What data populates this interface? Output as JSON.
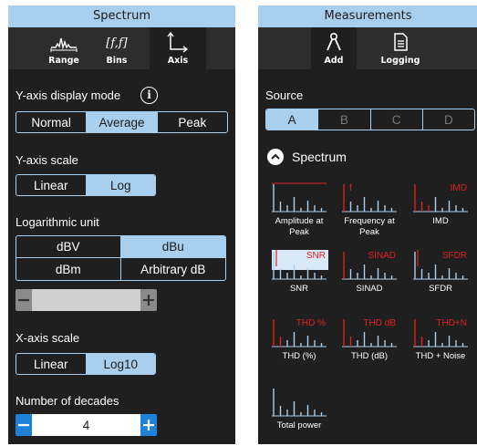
{
  "left_panel": {
    "title": "Spectrum",
    "tabs": [
      {
        "label": "Range",
        "icon": "range-icon"
      },
      {
        "label": "Bins",
        "icon": "bins-icon"
      },
      {
        "label": "Axis",
        "icon": "axis-icon"
      }
    ],
    "selected_tab": "Axis",
    "y_display_mode": {
      "label": "Y-axis display mode",
      "options": [
        "Normal",
        "Average",
        "Peak"
      ],
      "selected": "Average"
    },
    "y_scale": {
      "label": "Y-axis scale",
      "options": [
        "Linear",
        "Log"
      ],
      "selected": "Log"
    },
    "log_unit": {
      "label": "Logarithmic unit",
      "options": [
        "dBV",
        "dBu",
        "dBm",
        "Arbitrary dB"
      ],
      "selected": "dBu",
      "stepper_value": "",
      "stepper_minus": "−",
      "stepper_plus": "+"
    },
    "x_scale": {
      "label": "X-axis scale",
      "options": [
        "Linear",
        "Log10"
      ],
      "selected": "Log10"
    },
    "decades": {
      "label": "Number of decades",
      "value": "4",
      "minus": "−",
      "plus": "+"
    }
  },
  "right_panel": {
    "title": "Measurements",
    "tabs": [
      {
        "label": "Add",
        "icon": "add-probe-icon"
      },
      {
        "label": "Logging",
        "icon": "logging-document-icon"
      }
    ],
    "selected_tab": "Add",
    "source": {
      "label": "Source",
      "options": [
        "A",
        "B",
        "C",
        "D"
      ],
      "selected": "A"
    },
    "section": {
      "title": "Spectrum",
      "icon": "collapse-chevron-icon"
    },
    "tiles": [
      {
        "name": "Amplitude at Peak",
        "overlay": ""
      },
      {
        "name": "Frequency at Peak",
        "overlay": "f"
      },
      {
        "name": "IMD",
        "overlay": "IMD"
      },
      {
        "name": "SNR",
        "overlay": "SNR"
      },
      {
        "name": "SINAD",
        "overlay": "SINAD"
      },
      {
        "name": "SFDR",
        "overlay": "SFDR"
      },
      {
        "name": "THD (%)",
        "overlay": "THD %"
      },
      {
        "name": "THD (dB)",
        "overlay": "THD dB"
      },
      {
        "name": "THD + Noise",
        "overlay": "THD+N"
      },
      {
        "name": "Total power",
        "overlay": ""
      }
    ],
    "colors": {
      "overlay_red": "#e02020",
      "bars": "#a9cfee",
      "highlight": "#a9cfee"
    }
  },
  "colors": {
    "accent": "#a9cfee",
    "panel_bg": "#1f1f1f",
    "stepper_blue": "#1e82d8"
  }
}
